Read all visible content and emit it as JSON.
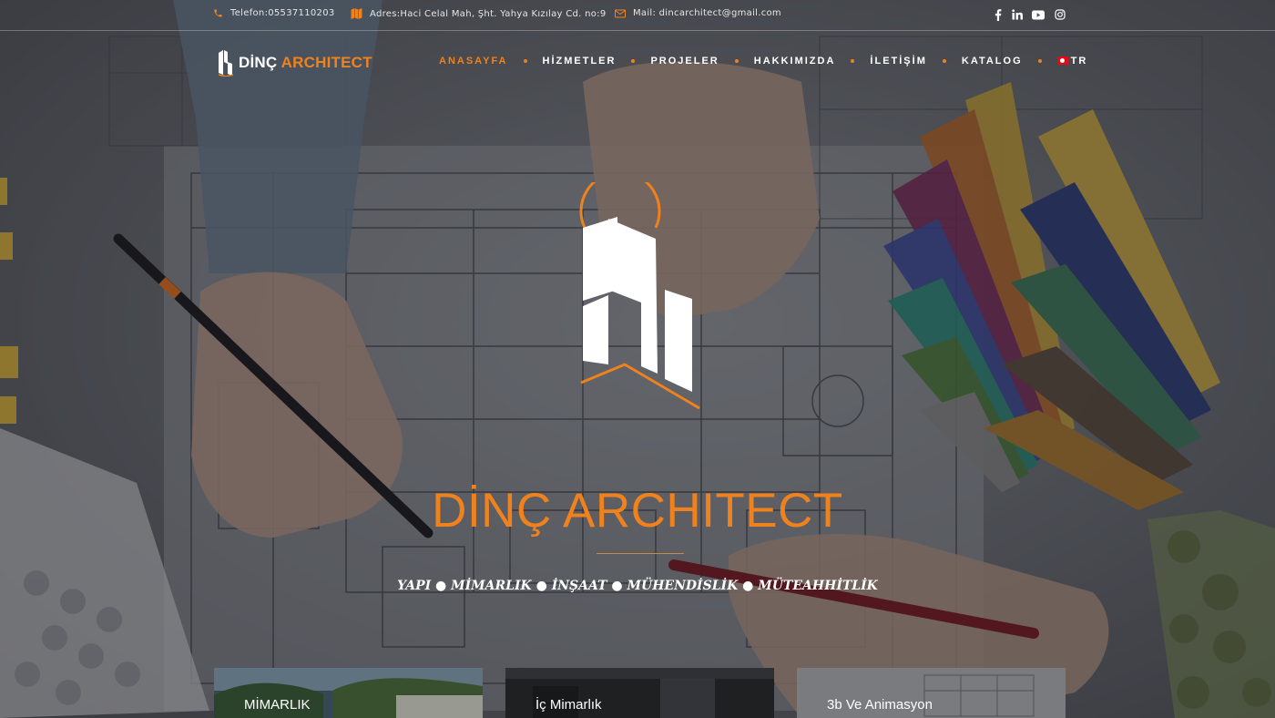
{
  "topbar": {
    "phone_text": "Telefon:05537110203",
    "address_text": "Adres:Haci Celal Mah, Şht. Yahya Kızılay Cd. no:9",
    "mail_text": "Mail: dincarchitect@gmail.com",
    "icons": {
      "phone": "phone-icon",
      "address": "map-icon",
      "mail": "envelope-icon"
    },
    "social": [
      "facebook-icon",
      "linkedin-icon",
      "youtube-icon",
      "instagram-icon"
    ]
  },
  "logo": {
    "part1": "DİNÇ",
    "part2": "ARCHITECT"
  },
  "nav": {
    "items": [
      {
        "label": "ANASAYFA",
        "active": true
      },
      {
        "label": "HİZMETLER",
        "active": false
      },
      {
        "label": "PROJELER",
        "active": false
      },
      {
        "label": "HAKKIMIZDA",
        "active": false
      },
      {
        "label": "İLETİŞİM",
        "active": false
      },
      {
        "label": "KATALOG",
        "active": false
      }
    ],
    "language": "TR",
    "language_flag": "turkey-flag-icon"
  },
  "hero": {
    "title": "DİNÇ ARCHITECT",
    "subtitle": "YAPI ● MİMARLIK ● İNŞAAT ● MÜHENDİSLİK ● MÜTEAHHİTLİK"
  },
  "cards": [
    {
      "label": "MİMARLIK"
    },
    {
      "label": "İç Mimarlık"
    },
    {
      "label": "3b Ve Animasyon"
    }
  ],
  "colors": {
    "accent": "#f0821e",
    "text": "#ffffff"
  }
}
